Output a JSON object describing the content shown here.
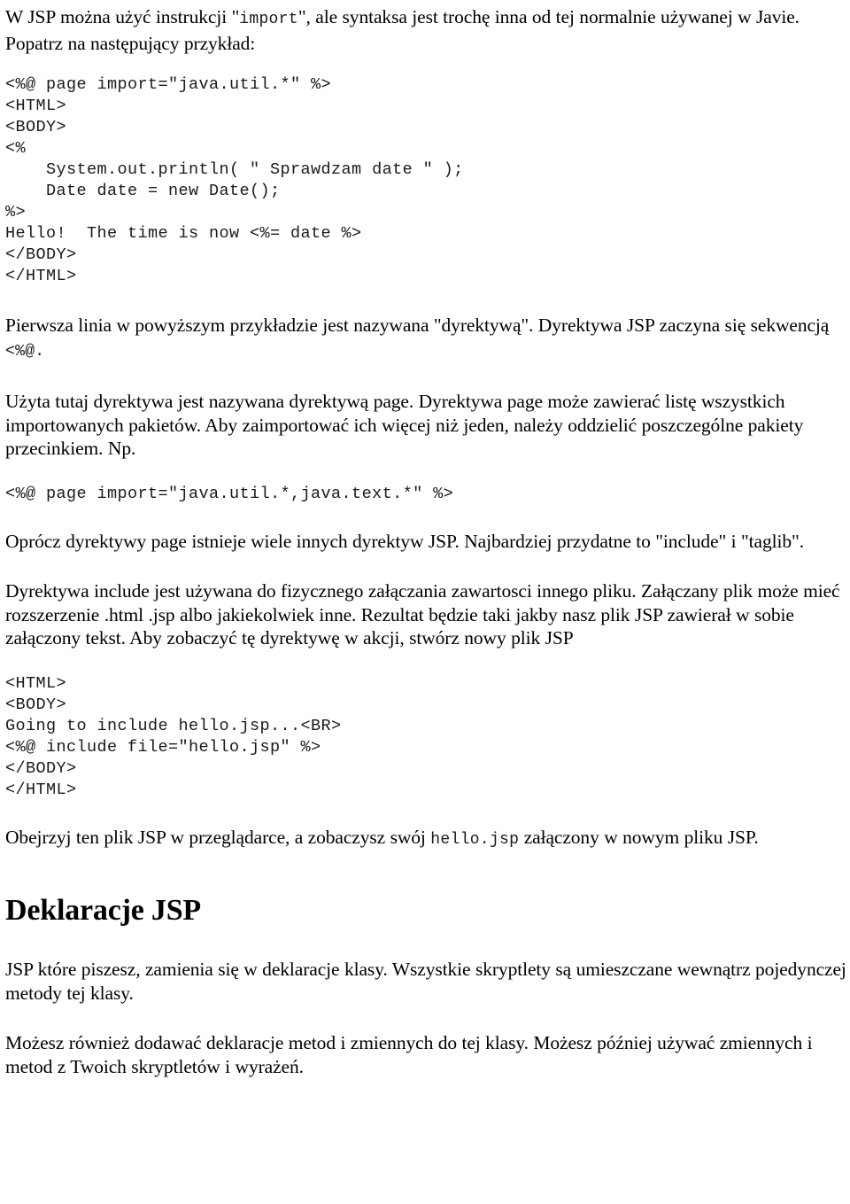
{
  "document": {
    "heading": "Deklaracje JSP",
    "intro": {
      "part1": "W JSP można użyć instrukcji \"",
      "code1": "import",
      "part2": "\", ale syntaksa jest trochę inna od tej normalnie używanej w Javie.  Popatrz na następujący przykład:"
    },
    "code_block_1": "<%@ page import=\"java.util.*\" %>\n<HTML>\n<BODY>\n<%\n    System.out.println( \" Sprawdzam date \" );\n    Date date = new Date();\n%>\nHello!  The time is now <%= date %>\n</BODY>\n</HTML>",
    "para_directive": {
      "part1": "Pierwsza linia w powyższym przykładzie jest nazywana \"dyrektywą\".  Dyrektywa JSP zaczyna się sekwencją ",
      "code1": "<%@.",
      "part2": ""
    },
    "para_page_directive": "Użyta tutaj dyrektywa jest nazywana dyrektywą page.  Dyrektywa page może zawierać listę wszystkich importowanych pakietów.  Aby zaimportować ich więcej niż jeden, należy oddzielić poszczególne pakiety przecinkiem. Np.",
    "code_block_2": "<%@ page import=\"java.util.*,java.text.*\" %>",
    "para_other_directives": "Oprócz dyrektywy page istnieje wiele innych dyrektyw JSP.  Najbardziej przydatne to \"include\" i \"taglib\".",
    "para_include": "Dyrektywa include jest używana do fizycznego załączania zawartosci innego pliku. Załączany plik może mieć rozszerzenie .html .jsp albo jakiekolwiek inne. Rezultat będzie taki jakby nasz plik JSP zawierał w sobie załączony tekst.  Aby zobaczyć tę dyrektywę w akcji, stwórz nowy plik JSP",
    "code_block_3": "<HTML>\n<BODY>\nGoing to include hello.jsp...<BR>\n<%@ include file=\"hello.jsp\" %>\n</BODY>\n</HTML>",
    "para_browser": {
      "part1": "Obejrzyj ten plik JSP w przeglądarce, a zobaczysz swój ",
      "code1": "hello.jsp",
      "part2": " załączony w nowym pliku JSP."
    },
    "para_declarations_1": "JSP które piszesz, zamienia się w deklaracje klasy.  Wszystkie skryptlety są umieszczane wewnątrz pojedynczej metody tej klasy.",
    "para_declarations_2": "Możesz również dodawać deklaracje metod i zmiennych do tej klasy.   Możesz później używać zmiennych i metod z Twoich skryptletów i wyrażeń."
  },
  "colors": {
    "background": "#ffffff",
    "text": "#000000",
    "code_text": "#1a1a1a"
  }
}
